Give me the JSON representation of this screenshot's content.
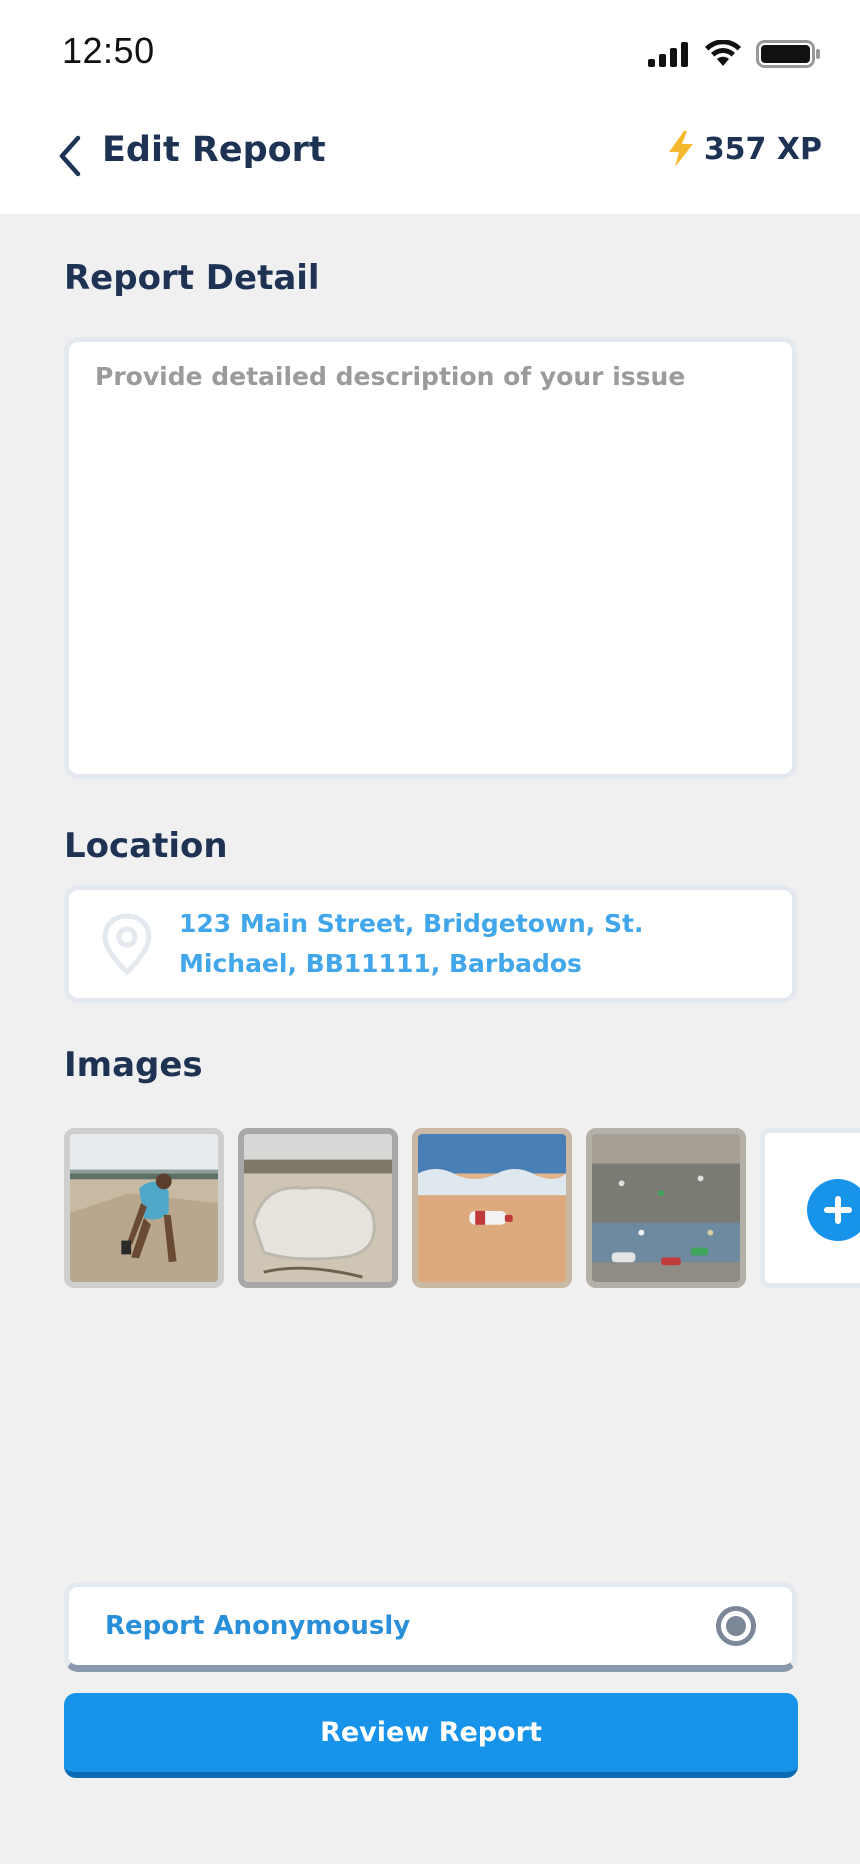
{
  "status_bar": {
    "time": "12:50"
  },
  "header": {
    "title": "Edit Report",
    "xp": "357 XP"
  },
  "report_detail": {
    "label": "Report Detail",
    "value": "",
    "placeholder": "Provide detailed description of your issue"
  },
  "location": {
    "label": "Location",
    "address": "123 Main Street, Bridgetown, St. Michael, BB11111, Barbados"
  },
  "images": {
    "label": "Images",
    "items": [
      {
        "icon": "beach-cleanup-photo"
      },
      {
        "icon": "plastic-debris-photo"
      },
      {
        "icon": "bottle-on-beach-photo"
      },
      {
        "icon": "littered-shore-photo"
      }
    ],
    "add_icon": "plus-icon"
  },
  "anonymous": {
    "label": "Report Anonymously",
    "selected": true
  },
  "actions": {
    "review_label": "Review Report"
  },
  "colors": {
    "primary": "#1793ea",
    "title": "#1e3354",
    "link": "#41a6ea",
    "background": "#f0f0f1"
  }
}
